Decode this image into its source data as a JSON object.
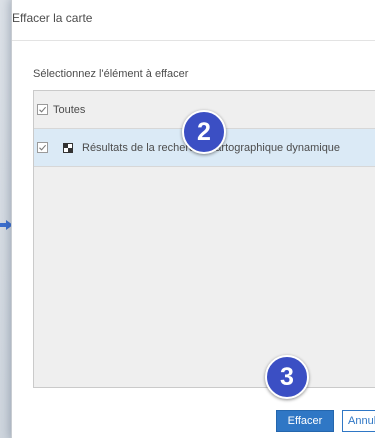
{
  "dialog": {
    "title": "Effacer la carte",
    "prompt": "Sélectionnez l'élément à effacer"
  },
  "list": {
    "all_label": "Toutes",
    "all_checked": true,
    "items": [
      {
        "label": "Résultats de la recherche cartographique dynamique",
        "checked": true,
        "icon": "map-grid-icon"
      }
    ]
  },
  "annotations": {
    "step_2": "2",
    "step_3": "3"
  },
  "buttons": {
    "clear_label": "Effacer",
    "cancel_label": "Annuler"
  },
  "colors": {
    "accent": "#2f77c5",
    "badge": "#3b4fc4",
    "selected_row": "#dbeaf6"
  }
}
